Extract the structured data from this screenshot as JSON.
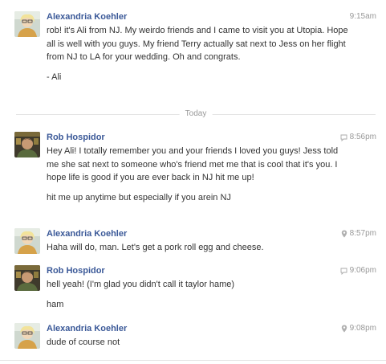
{
  "conversation": {
    "divider_label": "Today",
    "messages": [
      {
        "author": "Alexandria Koehler",
        "time": "9:15am",
        "source_icon": "",
        "paragraphs": [
          "rob! it's Ali from NJ. My weirdo friends and I came to visit you at Utopia. Hope all is well with you guys. My friend Terry actually sat next to Jess on her flight from NJ to LA for your wedding. Oh and congrats.",
          "- Ali"
        ]
      },
      {
        "author": "Rob Hospidor",
        "time": "8:56pm",
        "source_icon": "chat-bubble-icon",
        "paragraphs": [
          "Hey Ali! I totally remember you and your friends I loved you guys! Jess told me she sat next to someone who's friend met me that is cool that it's you. I hope life is good if you are ever back in NJ hit me up!",
          "hit me up anytime but especially if you arein NJ"
        ]
      },
      {
        "author": "Alexandria Koehler",
        "time": "8:57pm",
        "source_icon": "location-pin-icon",
        "paragraphs": [
          "Haha will do, man. Let's get a pork roll egg and cheese."
        ]
      },
      {
        "author": "Rob Hospidor",
        "time": "9:06pm",
        "source_icon": "chat-bubble-icon",
        "paragraphs": [
          "hell yeah! (I'm glad you didn't call it taylor hame)",
          "ham"
        ]
      },
      {
        "author": "Alexandria Koehler",
        "time": "9:08pm",
        "source_icon": "location-pin-icon",
        "paragraphs": [
          "dude of course not"
        ]
      }
    ]
  }
}
